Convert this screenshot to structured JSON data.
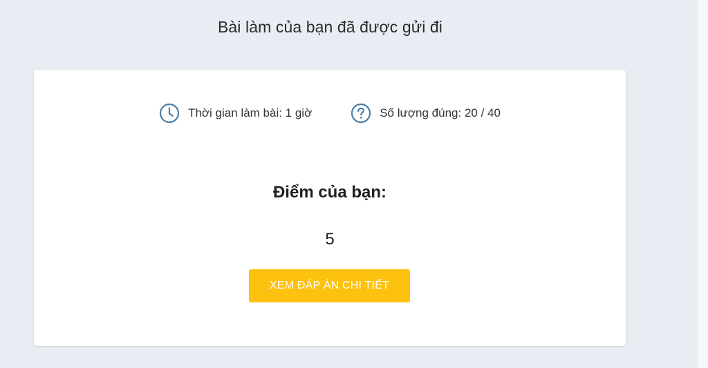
{
  "page_title": "Bài làm của bạn đã được gửi đi",
  "stats": {
    "time_label": "Thời gian làm bài: 1 giờ",
    "time_icon": "clock-icon",
    "correct_label": "Số lượng đúng: 20 / 40",
    "correct_icon": "question-circle-icon"
  },
  "score": {
    "heading": "Điểm của bạn:",
    "value": "5"
  },
  "actions": {
    "view_answers_label": "XEM ĐÁP ÁN CHI TIẾT"
  },
  "colors": {
    "background": "#e9ecf2",
    "card": "#ffffff",
    "accent_button": "#fdc20f",
    "icon": "#4a7fa8"
  }
}
